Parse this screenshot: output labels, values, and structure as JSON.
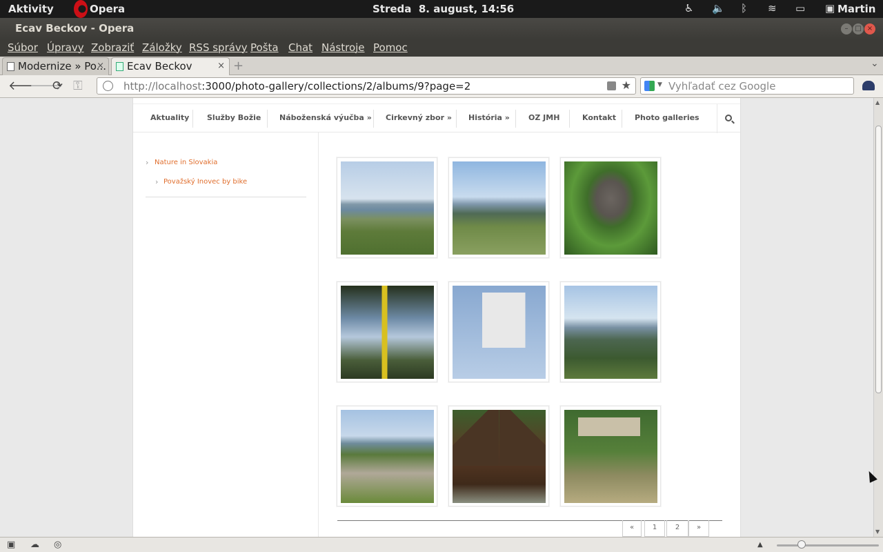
{
  "topbar": {
    "activities": "Aktivity",
    "app": "Opera",
    "clock": "Streda  8. august, 14:56",
    "user": "Martin",
    "indicators": [
      "accessibility-icon",
      "volume-icon",
      "bluetooth-icon",
      "wifi-icon",
      "battery-icon",
      "user-icon"
    ]
  },
  "window": {
    "title": "Ecav Beckov - Opera"
  },
  "menu": [
    "Súbor",
    "Úpravy",
    "Zobraziť",
    "Záložky",
    "RSS správy",
    "Pošta",
    "Chat",
    "Nástroje",
    "Pomoc"
  ],
  "tabs": [
    {
      "label": "Modernize » Po..."
    },
    {
      "label": "Ecav Beckov"
    }
  ],
  "address": {
    "url_host": "http://localhost",
    "url_rest": ":3000/photo-gallery/collections/2/albums/9?page=2",
    "search_placeholder": "Vyhľadať cez Google"
  },
  "site": {
    "nav": [
      "Aktuality",
      "Služby Božie",
      "Náboženská výučba  »",
      "Cirkevný zbor  »",
      "História  »",
      "OZ JMH",
      "Kontakt",
      "Photo galleries"
    ],
    "sidebar": {
      "collection": "Nature in Slovakia",
      "album": "Považský Inovec by bike"
    },
    "photos": [
      {
        "name": "photo-mountain-view-1",
        "scene": "landscape"
      },
      {
        "name": "photo-mountain-view-2",
        "scene": "landscape"
      },
      {
        "name": "photo-wayside-shrine",
        "scene": "shrine"
      },
      {
        "name": "photo-trail-signpost-tree",
        "scene": "signpost"
      },
      {
        "name": "photo-trail-sign-sky",
        "scene": "sign"
      },
      {
        "name": "photo-forest-valley",
        "scene": "landscape"
      },
      {
        "name": "photo-meadow-logs",
        "scene": "meadow"
      },
      {
        "name": "photo-wooden-hut",
        "scene": "hut"
      },
      {
        "name": "photo-spring-sign",
        "scene": "spring"
      }
    ],
    "pager": [
      "«",
      "1",
      "2",
      "»"
    ]
  },
  "colors": {
    "accent": "#e06e2d",
    "topbar": "#1a1a1a",
    "window": "#3c3b37"
  }
}
